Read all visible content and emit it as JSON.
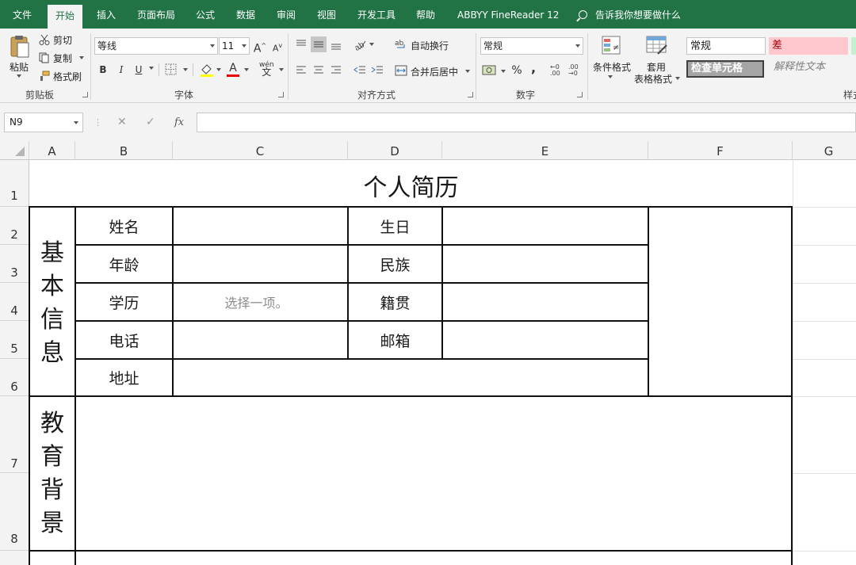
{
  "menu": {
    "tabs": [
      "文件",
      "开始",
      "插入",
      "页面布局",
      "公式",
      "数据",
      "审阅",
      "视图",
      "开发工具",
      "帮助",
      "ABBYY FineReader 12"
    ],
    "active": "开始",
    "tell_me": "告诉我你想要做什么"
  },
  "ribbon": {
    "clipboard": {
      "paste": "粘贴",
      "cut": "剪切",
      "copy": "复制",
      "format_painter": "格式刷",
      "group": "剪贴板"
    },
    "font": {
      "name": "等线",
      "size": "11",
      "bold": "B",
      "italic": "I",
      "underline": "U",
      "grow": "A",
      "shrink": "A",
      "phonetic": "wén",
      "group": "字体"
    },
    "alignment": {
      "wrap": "自动换行",
      "merge": "合并后居中",
      "group": "对齐方式"
    },
    "number": {
      "format": "常规",
      "percent": "%",
      "comma": ",",
      "group": "数字"
    },
    "styles": {
      "conditional": "条件格式",
      "table_format_1": "套用",
      "table_format_2": "表格格式",
      "normal": "常规",
      "bad": "差",
      "check": "检查单元格",
      "explanatory": "解释性文本",
      "group": "样式"
    }
  },
  "formula_bar": {
    "name_box": "N9",
    "cancel": "✕",
    "enter": "✓",
    "fx": "fx",
    "content": ""
  },
  "columns": [
    "A",
    "B",
    "C",
    "D",
    "E",
    "F",
    "G"
  ],
  "rows": [
    "1",
    "2",
    "3",
    "4",
    "5",
    "6",
    "7",
    "8"
  ],
  "sheet": {
    "title": "个人简历",
    "section_basic": "基本信息",
    "section_edu": "教育背景",
    "name_label": "姓名",
    "age_label": "年龄",
    "education_label": "学历",
    "education_placeholder": "选择一项。",
    "phone_label": "电话",
    "address_label": "地址",
    "birthday_label": "生日",
    "ethnicity_label": "民族",
    "hometown_label": "籍贯",
    "email_label": "邮箱"
  },
  "colors": {
    "accent": "#217346",
    "bad_bg": "#ffc7ce",
    "bad_text": "#9c0006",
    "check_bg": "#a5a5a5"
  }
}
